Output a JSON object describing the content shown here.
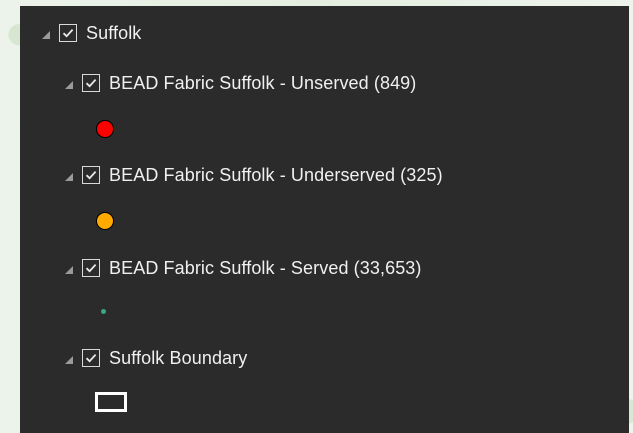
{
  "root": {
    "label": "Suffolk",
    "checked": true,
    "layers": [
      {
        "label": "BEAD Fabric Suffolk - Unserved (849)",
        "checked": true,
        "symbol": {
          "shape": "circle",
          "color": "#ff0000"
        }
      },
      {
        "label": "BEAD Fabric Suffolk - Underserved (325)",
        "checked": true,
        "symbol": {
          "shape": "circle",
          "color": "#ffaa00"
        }
      },
      {
        "label": "BEAD Fabric Suffolk - Served (33,653)",
        "checked": true,
        "symbol": {
          "shape": "circle",
          "color": "#38a887"
        }
      },
      {
        "label": "Suffolk Boundary",
        "checked": true,
        "symbol": {
          "shape": "hollow-rectangle",
          "color": "#ffffff"
        }
      }
    ]
  },
  "icons": {
    "expander": "expanded-triangle-icon",
    "checkbox": "checkmark-icon"
  }
}
